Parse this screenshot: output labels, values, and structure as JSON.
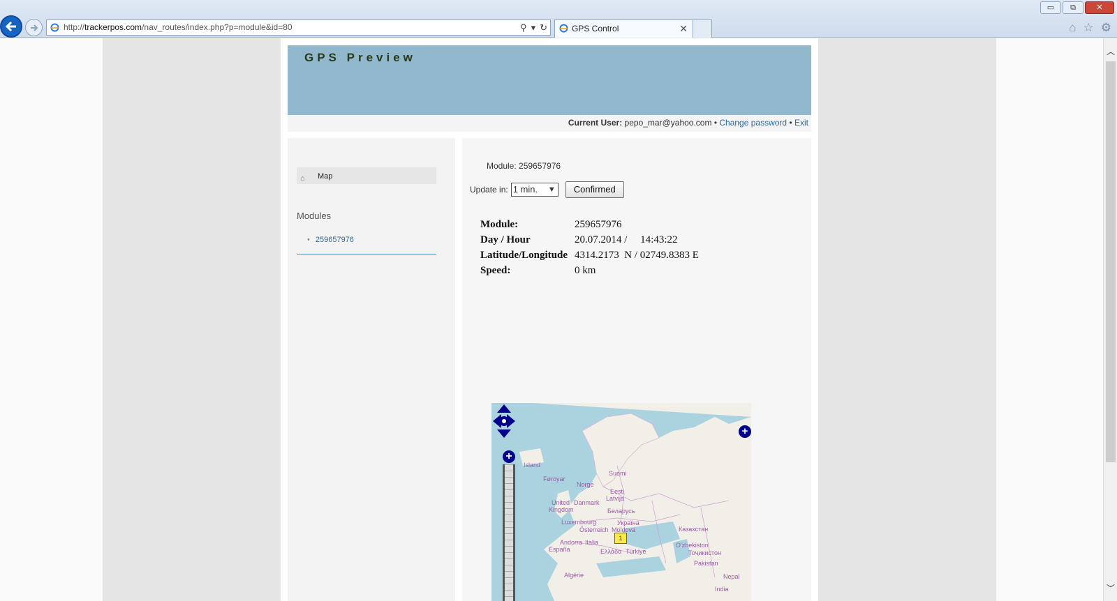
{
  "browser": {
    "url_prefix": "http://",
    "url_host": "trackerpos.com",
    "url_path": "/nav_routes/index.php?p=module&id=80",
    "tab_title": "GPS Control",
    "tab_close": "✕",
    "win_min": "▭",
    "win_restore": "⧉",
    "win_close": "✕"
  },
  "header": {
    "title": "GPS Preview"
  },
  "userbar": {
    "label": "Current User:",
    "user": "pepo_mar@yahoo.com",
    "sep": "•",
    "change_password": "Change password",
    "exit": "Exit"
  },
  "sidebar": {
    "menu_map": "Map",
    "modules_title": "Modules",
    "modules": [
      "259657976"
    ]
  },
  "main": {
    "module_label": "Module: 259657976",
    "update_label": "Update in:",
    "update_value": "1 min.",
    "confirm_label": "Confirmed",
    "info": [
      {
        "key": "Module:",
        "value": "259657976"
      },
      {
        "key": "Day / Hour",
        "value": "20.07.2014 /     14:43:22"
      },
      {
        "key": "Latitude/Longitude",
        "value": "4314.2173  N / 02749.8383 E"
      },
      {
        "key": "Speed:",
        "value": "0 km"
      }
    ]
  },
  "map": {
    "labels": [
      {
        "text": "Island"
      },
      {
        "text": "Føroyar"
      },
      {
        "text": "Norge"
      },
      {
        "text": "Suomi"
      },
      {
        "text": "Eesti"
      },
      {
        "text": "Latvija"
      },
      {
        "text": "United"
      },
      {
        "text": "Kingdom"
      },
      {
        "text": "Danmark"
      },
      {
        "text": "Беларусь"
      },
      {
        "text": "Luxembourg"
      },
      {
        "text": "Україна"
      },
      {
        "text": "Österreich"
      },
      {
        "text": "Moldova"
      },
      {
        "text": "Казахстан"
      },
      {
        "text": "Andorra"
      },
      {
        "text": "Italia"
      },
      {
        "text": "España"
      },
      {
        "text": "Ελλάδα"
      },
      {
        "text": "Türkiye"
      },
      {
        "text": "O'zbekiston"
      },
      {
        "text": "Тоҷикистон"
      },
      {
        "text": "Pakistan"
      },
      {
        "text": "Algérie"
      },
      {
        "text": "Nepal"
      },
      {
        "text": "India"
      }
    ],
    "marker_label": "1",
    "zoom_in": "+",
    "layer_switch": "+"
  },
  "colors": {
    "header_bg": "#91b8cc",
    "link": "#2a6a9a",
    "map_water": "#aad3df",
    "map_land": "#f2efe9"
  }
}
